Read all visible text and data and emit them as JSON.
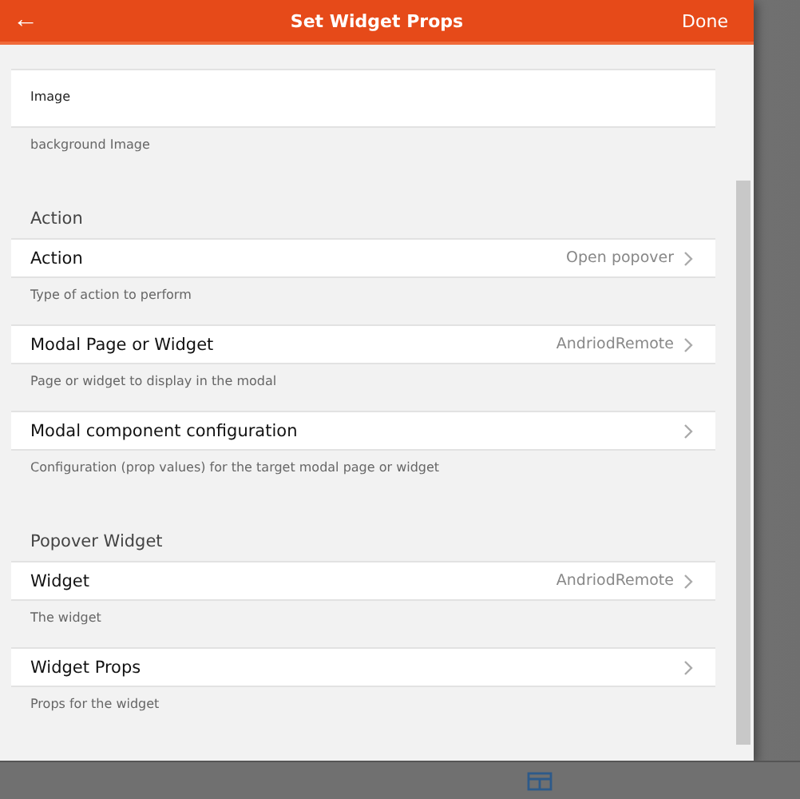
{
  "header": {
    "back": "←",
    "title": "Set Widget Props",
    "done": "Done"
  },
  "items": [
    {
      "kind": "field",
      "label": "Image",
      "description": "background Image"
    },
    {
      "kind": "section",
      "title": "Action"
    },
    {
      "kind": "row",
      "label": "Action",
      "value": "Open popover",
      "description": "Type of action to perform"
    },
    {
      "kind": "row",
      "label": "Modal Page or Widget",
      "value": "AndriodRemote",
      "description": "Page or widget to display in the modal"
    },
    {
      "kind": "row",
      "label": "Modal component configuration",
      "description": "Configuration (prop values) for the target modal page or widget"
    },
    {
      "kind": "section",
      "title": "Popover Widget"
    },
    {
      "kind": "row",
      "label": "Widget",
      "value": "AndriodRemote",
      "description": "The widget"
    },
    {
      "kind": "row",
      "label": "Widget Props",
      "description": "Props for the widget"
    }
  ]
}
